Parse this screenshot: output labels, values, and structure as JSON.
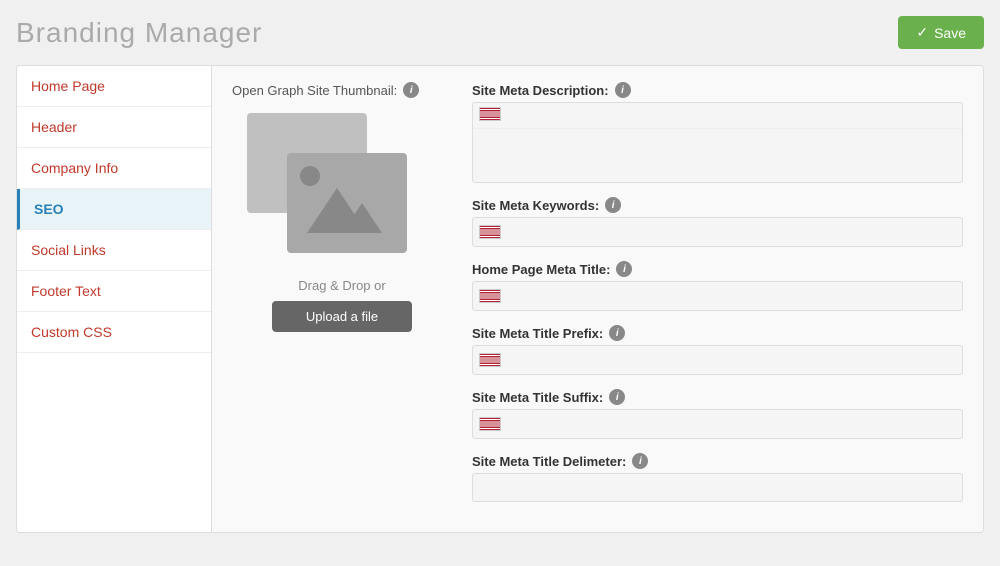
{
  "header": {
    "title": "Branding Manager",
    "save_button": "Save"
  },
  "sidebar": {
    "items": [
      {
        "id": "home-page",
        "label": "Home Page",
        "active": false
      },
      {
        "id": "header",
        "label": "Header",
        "active": false
      },
      {
        "id": "company-info",
        "label": "Company Info",
        "active": false
      },
      {
        "id": "seo",
        "label": "SEO",
        "active": true
      },
      {
        "id": "social-links",
        "label": "Social Links",
        "active": false
      },
      {
        "id": "footer-text",
        "label": "Footer Text",
        "active": false
      },
      {
        "id": "custom-css",
        "label": "Custom CSS",
        "active": false
      }
    ]
  },
  "thumbnail": {
    "label": "Open Graph Site Thumbnail:",
    "drag_text": "Drag & Drop or",
    "upload_button": "Upload a file"
  },
  "fields": [
    {
      "id": "site-meta-description",
      "label": "Site Meta Description:",
      "type": "textarea",
      "has_flag": true,
      "value": ""
    },
    {
      "id": "site-meta-keywords",
      "label": "Site Meta Keywords:",
      "type": "input",
      "has_flag": true,
      "value": ""
    },
    {
      "id": "home-page-meta-title",
      "label": "Home Page Meta Title:",
      "type": "input",
      "has_flag": true,
      "value": ""
    },
    {
      "id": "site-meta-title-prefix",
      "label": "Site Meta Title Prefix:",
      "type": "input",
      "has_flag": true,
      "value": ""
    },
    {
      "id": "site-meta-title-suffix",
      "label": "Site Meta Title Suffix:",
      "type": "input",
      "has_flag": true,
      "value": ""
    },
    {
      "id": "site-meta-title-delimeter",
      "label": "Site Meta Title Delimeter:",
      "type": "simple-input",
      "has_flag": false,
      "value": ""
    }
  ],
  "icons": {
    "info": "i",
    "checkmark": "✓"
  }
}
